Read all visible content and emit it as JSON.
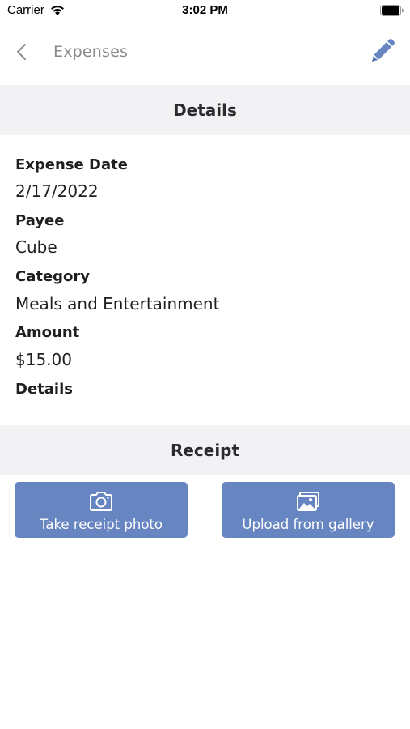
{
  "status_bar": {
    "carrier": "Carrier",
    "time": "3:02 PM"
  },
  "nav": {
    "back_label": "Expenses",
    "back_icon": "chevron-left-icon",
    "edit_icon": "pencil-icon",
    "accent_color": "#6786c1"
  },
  "details": {
    "section_title": "Details",
    "fields": [
      {
        "label": "Expense Date",
        "value": "2/17/2022"
      },
      {
        "label": "Payee",
        "value": "Cube"
      },
      {
        "label": "Category",
        "value": "Meals and Entertainment"
      },
      {
        "label": "Amount",
        "value": "$15.00"
      },
      {
        "label": "Details",
        "value": ""
      }
    ]
  },
  "receipt": {
    "section_title": "Receipt",
    "take_photo_label": "Take receipt photo",
    "take_photo_icon": "camera-icon",
    "upload_label": "Upload from gallery",
    "upload_icon": "gallery-icon",
    "button_color": "#6786c1"
  }
}
